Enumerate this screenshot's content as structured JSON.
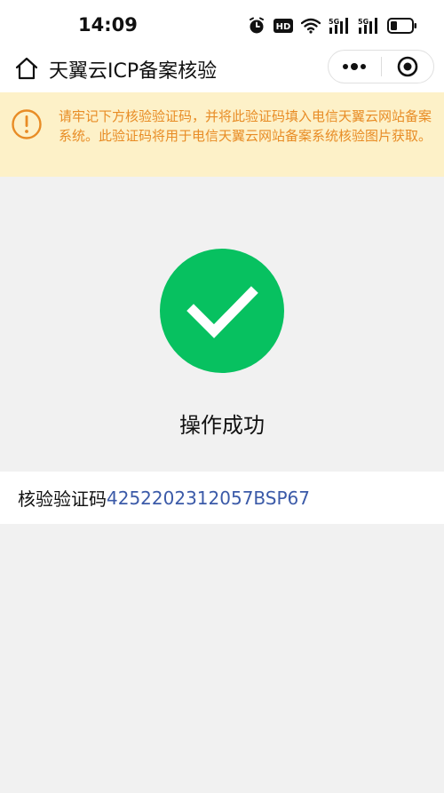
{
  "status_bar": {
    "time": "14:09",
    "icons": [
      "alarm-icon",
      "hd-icon",
      "wifi-icon",
      "signal-5g-icon",
      "signal-5g-icon",
      "battery-icon"
    ],
    "hd_label": "HD",
    "network_label": "5G"
  },
  "nav": {
    "title": "天翼云ICP备案核验",
    "home_icon": "home-icon",
    "more_icon": "more-dots-icon",
    "close_icon": "mini-program-close-icon"
  },
  "notice": {
    "text": "请牢记下方核验验证码，并将此验证码填入电信天翼云网站备案系统。此验证码将用于电信天翼云网站备案系统核验图片获取。",
    "icon": "info-icon",
    "color": "#e88c25"
  },
  "result": {
    "icon": "success-check-icon",
    "text": "操作成功",
    "color": "#07c160"
  },
  "code": {
    "label": "核验验证码",
    "value": "4252202312057BSP67",
    "value_color": "#3b5aa8"
  }
}
